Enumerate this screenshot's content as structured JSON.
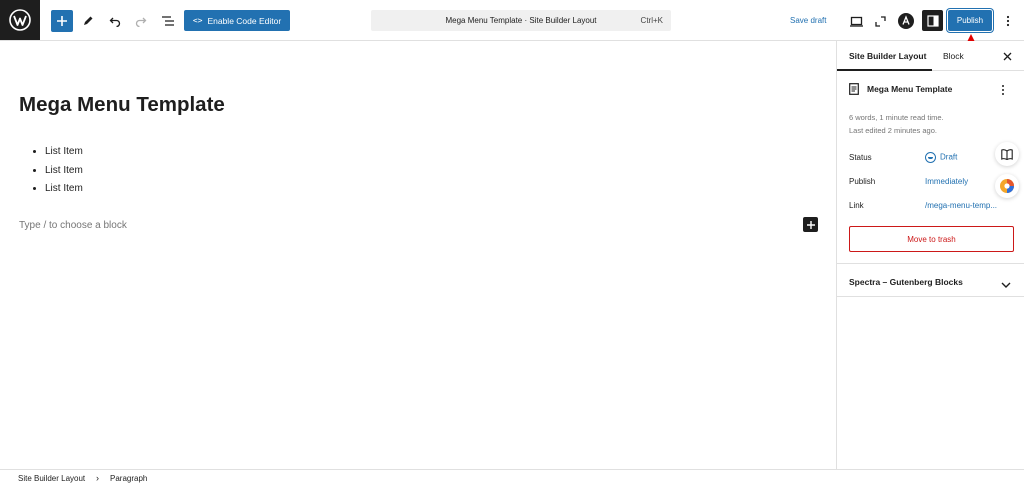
{
  "toolbar": {
    "code_editor_label": "Enable Code Editor",
    "command_title": "Mega Menu Template · Site Builder Layout",
    "command_shortcut": "Ctrl+K",
    "save_draft_label": "Save draft",
    "publish_label": "Publish"
  },
  "editor": {
    "title": "Mega Menu Template",
    "list_items": [
      "List Item",
      "List Item",
      "List Item"
    ],
    "placeholder": "Type / to choose a block"
  },
  "sidebar": {
    "tabs": [
      "Site Builder Layout",
      "Block"
    ],
    "doc_title": "Mega Menu Template",
    "meta_line1": "6 words, 1 minute read time.",
    "meta_line2": "Last edited 2 minutes ago.",
    "status_label": "Status",
    "status_value": "Draft",
    "publish_label": "Publish",
    "publish_value": "Immediately",
    "link_label": "Link",
    "link_value": "/mega-menu-temp...",
    "trash_label": "Move to trash",
    "spectra_label": "Spectra – Gutenberg Blocks"
  },
  "footer": {
    "breadcrumb": [
      "Site Builder Layout",
      "Paragraph"
    ]
  },
  "colors": {
    "accent": "#2271b1",
    "danger": "#cc1818",
    "annotation_arrow": "#e00000"
  }
}
